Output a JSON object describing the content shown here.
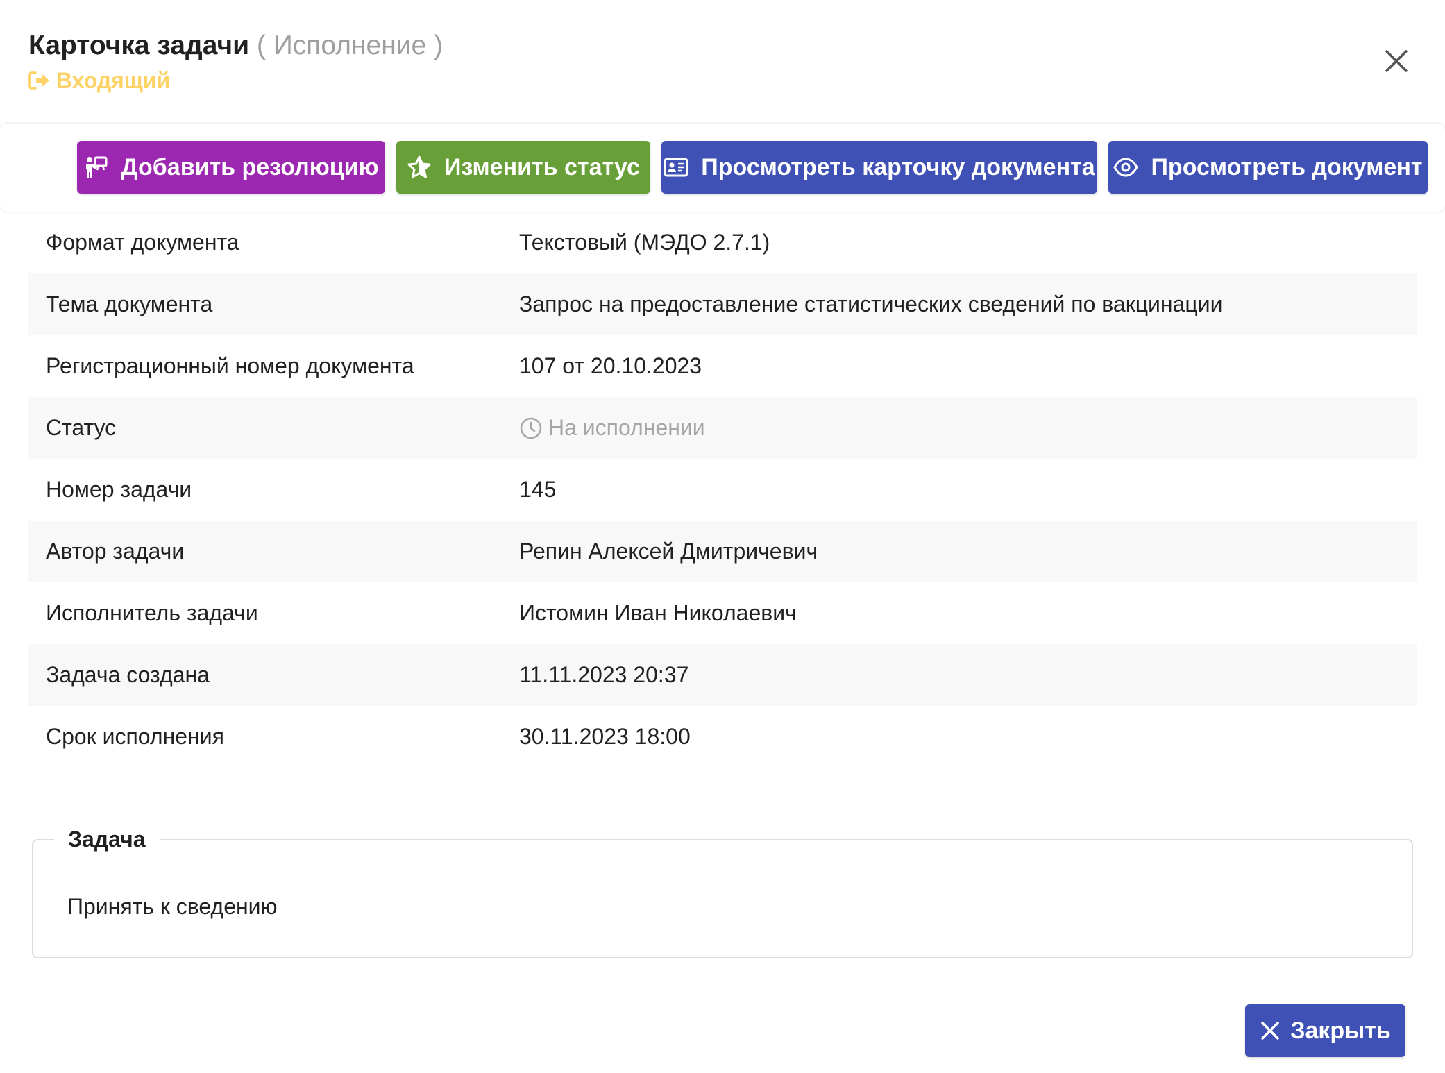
{
  "header": {
    "title": "Карточка задачи",
    "stage_open": "(",
    "stage": "Исполнение",
    "stage_close": ")",
    "direction": "Входящий"
  },
  "toolbar": {
    "add_resolution": "Добавить резолюцию",
    "change_status": "Изменить статус",
    "view_card": "Просмотреть карточку документа",
    "view_document": "Просмотреть документ"
  },
  "details": [
    {
      "label": "Формат документа",
      "value": "Текстовый (МЭДО 2.7.1)"
    },
    {
      "label": "Тема документа",
      "value": "Запрос на предоставление статистических сведений по вакцинации"
    },
    {
      "label": "Регистрационный номер документа",
      "value": "107 от 20.10.2023"
    },
    {
      "label": "Статус",
      "value": "На исполнении"
    },
    {
      "label": "Номер задачи",
      "value": "145"
    },
    {
      "label": "Автор задачи",
      "value": "Репин Алексей Дмитричевич"
    },
    {
      "label": "Исполнитель задачи",
      "value": "Истомин Иван Николаевич"
    },
    {
      "label": "Задача создана",
      "value": "11.11.2023 20:37"
    },
    {
      "label": "Срок исполнения",
      "value": "30.11.2023 18:00"
    }
  ],
  "task": {
    "legend": "Задача",
    "text": "Принять к сведению"
  },
  "footer": {
    "close_label": "Закрыть"
  },
  "colors": {
    "purple": "#9c27b0",
    "green": "#689f38",
    "blue": "#3f51b5",
    "incoming_yellow": "#fdd267",
    "muted": "#a6a6a6"
  }
}
